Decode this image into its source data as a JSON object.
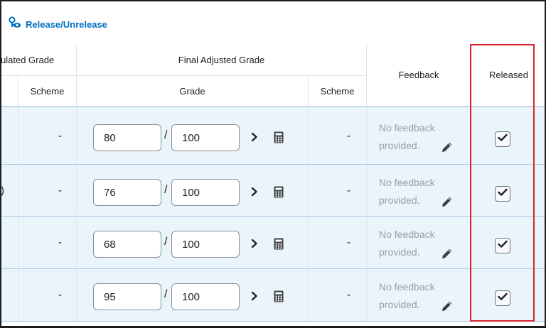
{
  "toolbar": {
    "release_label": "Release/Unrelease"
  },
  "headers": {
    "calculated_group": "ulated Grade",
    "calculated_scheme": "Scheme",
    "final_group": "Final Adjusted Grade",
    "final_grade": "Grade",
    "final_scheme": "Scheme",
    "feedback": "Feedback",
    "released": "Released"
  },
  "rows": [
    {
      "calc_scheme": "-",
      "grade": "80",
      "out_of": "100",
      "final_scheme": "-",
      "feedback_line1": "No feedback",
      "feedback_line2": "provided.",
      "released": true,
      "edge_text": ""
    },
    {
      "calc_scheme": "-",
      "grade": "76",
      "out_of": "100",
      "final_scheme": "-",
      "feedback_line1": "No feedback",
      "feedback_line2": "provided.",
      "released": true,
      "edge_text": ")"
    },
    {
      "calc_scheme": "-",
      "grade": "68",
      "out_of": "100",
      "final_scheme": "-",
      "feedback_line1": "No feedback",
      "feedback_line2": "provided.",
      "released": true,
      "edge_text": ""
    },
    {
      "calc_scheme": "-",
      "grade": "95",
      "out_of": "100",
      "final_scheme": "-",
      "feedback_line1": "No feedback",
      "feedback_line2": "provided.",
      "released": true,
      "edge_text": ""
    }
  ],
  "icons": {
    "toolbar": "release-key-eye-icon",
    "expand": "chevron-right-icon",
    "calculator": "calculator-icon",
    "edit": "pencil-icon",
    "released": "checkbox-checked-icon"
  },
  "colors": {
    "accent": "#006fbf",
    "row_background": "#eaf4fb",
    "highlight": "#d6262c"
  }
}
